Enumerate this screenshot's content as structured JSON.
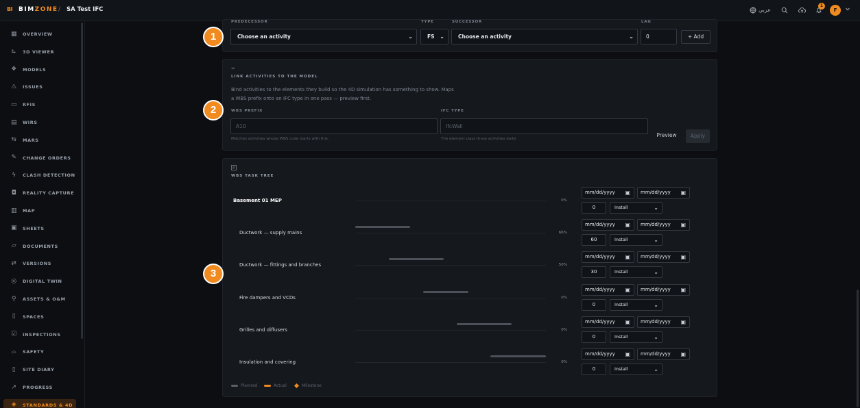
{
  "header": {
    "logo_badge": "BI",
    "brand_prefix": "BIM",
    "brand_suffix": "ZONE",
    "separator": "/",
    "project": "SA Test IFC",
    "language": "عربي",
    "notifications_count": "1",
    "avatar_initial": "F"
  },
  "sidebar": {
    "items": [
      {
        "label": "OVERVIEW",
        "icon": "grid-icon"
      },
      {
        "label": "3D VIEWER",
        "icon": "axis-icon"
      },
      {
        "label": "MODELS",
        "icon": "cubes-icon"
      },
      {
        "label": "ISSUES",
        "icon": "warning-icon"
      },
      {
        "label": "RFIS",
        "icon": "chat-icon"
      },
      {
        "label": "WIRS",
        "icon": "clipboard-icon"
      },
      {
        "label": "MARS",
        "icon": "file-transfer-icon"
      },
      {
        "label": "CHANGE ORDERS",
        "icon": "edit-doc-icon"
      },
      {
        "label": "CLASH DETECTION",
        "icon": "bolt-icon"
      },
      {
        "label": "REALITY CAPTURE",
        "icon": "camera-icon"
      },
      {
        "label": "MAP",
        "icon": "map-icon"
      },
      {
        "label": "SHEETS",
        "icon": "sheets-icon"
      },
      {
        "label": "DOCUMENTS",
        "icon": "folder-icon"
      },
      {
        "label": "VERSIONS",
        "icon": "versions-icon"
      },
      {
        "label": "DIGITAL TWIN",
        "icon": "twin-icon"
      },
      {
        "label": "ASSETS & O&M",
        "icon": "wrench-icon"
      },
      {
        "label": "SPACES",
        "icon": "building-icon"
      },
      {
        "label": "INSPECTIONS",
        "icon": "checklist-icon"
      },
      {
        "label": "SAFETY",
        "icon": "hardhat-icon"
      },
      {
        "label": "SITE DIARY",
        "icon": "book-icon"
      },
      {
        "label": "PROGRESS",
        "icon": "trend-icon"
      },
      {
        "label": "STANDARDS & 4D",
        "icon": "shield-check-icon"
      }
    ],
    "active": "STANDARDS & 4D"
  },
  "dependency": {
    "predecessor_label": "PREDECESSOR",
    "predecessor_value": "Choose an activity",
    "type_label": "TYPE",
    "type_value": "FS",
    "successor_label": "SUCCESSOR",
    "successor_value": "Choose an activity",
    "lag_label": "LAG",
    "lag_value": "0",
    "add_label": "+ Add"
  },
  "link": {
    "icon": "link-icon",
    "title": "LINK ACTIVITIES TO THE MODEL",
    "description_line1": "Bind activities to the elements they build so the 4D simulation has something to show. Maps",
    "description_line2": "a WBS prefix onto an IFC type in one pass — preview first.",
    "wbs_prefix_label": "WBS PREFIX",
    "wbs_prefix_placeholder": "A10",
    "wbs_prefix_hint": "Matches activities whose WBS code starts with this.",
    "ifc_type_label": "IFC TYPE",
    "ifc_type_placeholder": "IfcWall",
    "ifc_type_hint": "The element class those activities build.",
    "preview_label": "Preview",
    "apply_label": "Apply"
  },
  "wbs": {
    "title": "WBS TASK TREE",
    "date_placeholder": "mm/dd/yyyy",
    "rows": [
      {
        "name": "Basement 01 MEP",
        "pct": "0%",
        "progress": "0",
        "type": "Install",
        "bold": true
      },
      {
        "name": "Ductwork — supply mains",
        "pct": "66%",
        "progress": "60",
        "type": "Install",
        "bold": false
      },
      {
        "name": "Ductwork — fittings and branches",
        "pct": "50%",
        "progress": "30",
        "type": "Install",
        "bold": false
      },
      {
        "name": "Fire dampers and VCDs",
        "pct": "0%",
        "progress": "0",
        "type": "Install",
        "bold": false
      },
      {
        "name": "Grilles and diffusers",
        "pct": "0%",
        "progress": "0",
        "type": "Install",
        "bold": false
      },
      {
        "name": "Insulation and covering",
        "pct": "0%",
        "progress": "0",
        "type": "Install",
        "bold": false
      }
    ],
    "legend": {
      "planned": "Planned",
      "actual": "Actual",
      "milestone": "Milestone"
    }
  },
  "steps": [
    "1",
    "2",
    "3"
  ],
  "colors": {
    "accent": "#f28b1f",
    "background": "#0c0e11",
    "card": "#15181d"
  }
}
